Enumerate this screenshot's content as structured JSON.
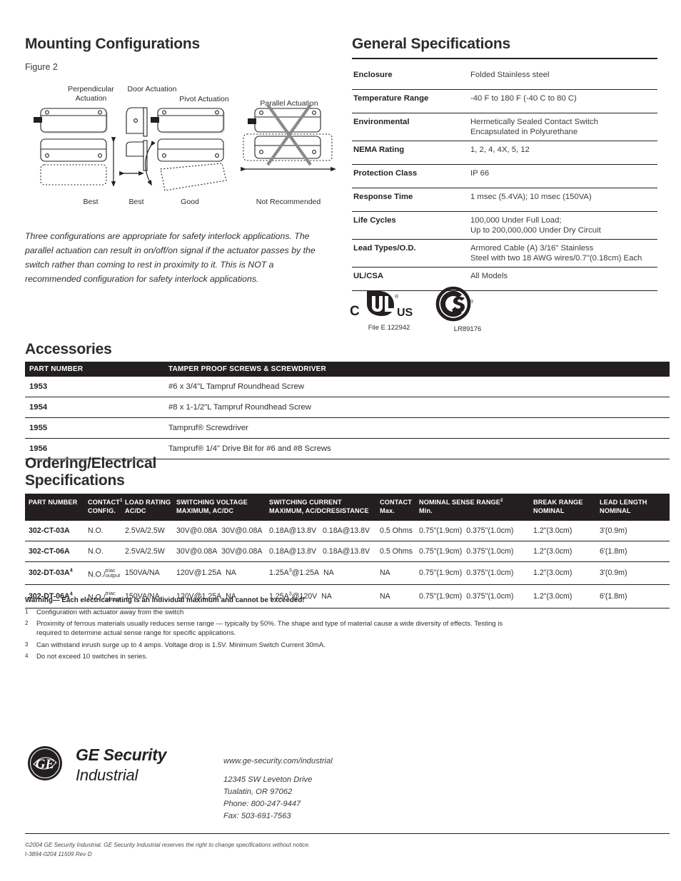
{
  "mounting": {
    "heading": "Mounting Configurations",
    "figure_label": "Figure 2",
    "captions_top": [
      "Perpendicular Actuation",
      "Door Actuation",
      "Pivot Actuation",
      "Parallel Actuation"
    ],
    "captions_bottom": [
      "Best",
      "Best",
      "Good",
      "Not Recommended"
    ],
    "note": "Three configurations are appropriate for safety interlock applications. The parallel actuation can result in on/off/on signal if the actuator passes by the switch rather than coming to rest in proximity to it. This is NOT a recommended configuration for safety interlock applications."
  },
  "general_specs": {
    "heading": "General Specifications",
    "rows": [
      {
        "key": "Enclosure",
        "values": [
          "Folded Stainless steel"
        ]
      },
      {
        "key": "Temperature Range",
        "values": [
          "-40  F to 180  F (-40  C to 80  C)"
        ]
      },
      {
        "key": "Environmental",
        "values": [
          "Hermetically Sealed Contact Switch",
          "Encapsulated in Polyurethane"
        ]
      },
      {
        "key": "NEMA Rating",
        "values": [
          "1, 2, 4, 4X, 5, 12"
        ]
      },
      {
        "key": "Protection Class",
        "values": [
          "IP 66"
        ]
      },
      {
        "key": "Response Time",
        "values": [
          "1 msec (5.4VA); 10 msec (150VA)"
        ]
      },
      {
        "key": "Life Cycles",
        "values": [
          "100,000 Under Full Load;",
          "Up to 200,000,000 Under Dry Circuit"
        ]
      },
      {
        "key": "Lead Types/O.D.",
        "values": [
          "Armored Cable (A) 3/16\" Stainless",
          "Steel with two 18 AWG wires/0.7\"(0.18cm) Each"
        ]
      },
      {
        "key": "UL/CSA",
        "values": [
          "All Models"
        ]
      }
    ]
  },
  "certifications": {
    "ul_file": "File E 122942",
    "csa_file": "LR89176",
    "ul_mark_left": "C",
    "ul_mark_right": "US"
  },
  "accessories": {
    "heading": "Accessories",
    "columns": [
      "PART NUMBER",
      "TAMPER PROOF SCREWS & SCREWDRIVER"
    ],
    "rows": [
      {
        "part": "1953",
        "desc": "#6 x 3/4\"L Tampruf Roundhead Screw"
      },
      {
        "part": "1954",
        "desc": "#8 x 1-1/2\"L Tampruf Roundhead Screw"
      },
      {
        "part": "1955",
        "desc": "Tampruf® Screwdriver"
      },
      {
        "part": "1956",
        "desc": "Tampruf® 1/4\" Drive Bit for #6 and #8 Screws"
      }
    ]
  },
  "ordering": {
    "heading_line1": "Ordering/Electrical",
    "heading_line2": "Specifications",
    "columns": [
      {
        "l1": "PART NUMBER",
        "l2": ""
      },
      {
        "l1": "CONTACT",
        "l1_sup": "1",
        "l2": "CONFIG."
      },
      {
        "l1": "LOAD RATING",
        "l2": "AC/DC"
      },
      {
        "l1": "SWITCHING VOLTAGE",
        "l2": "MAXIMUM, AC/DC"
      },
      {
        "l1": "SWITCHING CURRENT",
        "l2": "MAXIMUM, AC/DCRESISTANCE"
      },
      {
        "l1": "CONTACT",
        "l2": "Max."
      },
      {
        "l1": "NOMINAL SENSE RANGE",
        "l1_sup": "2",
        "l2": "Min."
      },
      {
        "l1": "BREAK RANGE",
        "l2": "NOMINAL"
      },
      {
        "l1": "LEAD LENGTH",
        "l2": "NOMINAL"
      }
    ],
    "rows": [
      {
        "part": "302-CT-03A",
        "part_sup": "",
        "config": "N.O.",
        "config_triac": false,
        "load": "2.5VA/2.5W",
        "volt_a": "30V@0.08A",
        "volt_b": "30V@0.08A",
        "cur_a": "0.18A@13.8V",
        "cur_a_sup": "",
        "cur_b": "0.18A@13.8V",
        "contact": "0.5 Ohms",
        "sense_a": "0.75\"(1.9cm)",
        "sense_b": "0.375\"(1.0cm)",
        "break_range": "1.2\"(3.0cm)",
        "lead": "3'(0.9m)"
      },
      {
        "part": "302-CT-06A",
        "part_sup": "",
        "config": "N.O.",
        "config_triac": false,
        "load": "2.5VA/2.5W",
        "volt_a": "30V@0.08A",
        "volt_b": "30V@0.08A",
        "cur_a": "0.18A@13.8V",
        "cur_a_sup": "",
        "cur_b": "0.18A@13.8V",
        "contact": "0.5 Ohms",
        "sense_a": "0.75\"(1.9cm)",
        "sense_b": "0.375\"(1.0cm)",
        "break_range": "1.2\"(3.0cm)",
        "lead": "6'(1.8m)"
      },
      {
        "part": "302-DT-03A",
        "part_sup": "4",
        "config": "N.O./",
        "config_triac": true,
        "load": "150VA/NA",
        "volt_a": "120V@1.25A",
        "volt_b": "NA",
        "cur_a": "1.25A",
        "cur_a_sup": "3",
        "cur_a_tail": "@1.25A",
        "cur_b": "NA",
        "contact": "NA",
        "sense_a": "0.75\"(1.9cm)",
        "sense_b": "0.375\"(1.0cm)",
        "break_range": "1.2\"(3.0cm)",
        "lead": "3'(0.9m)"
      },
      {
        "part": "302-DT-06A",
        "part_sup": "4",
        "config": "N.O./",
        "config_triac": true,
        "load": "150VA/NA",
        "volt_a": "120V@1.25A",
        "volt_b": "NA",
        "cur_a": "1.25A",
        "cur_a_sup": "3",
        "cur_a_tail": "@120V",
        "cur_b": "NA",
        "contact": "NA",
        "sense_a": "0.75\"(1.9cm)",
        "sense_b": "0.375\"(1.0cm)",
        "break_range": "1.2\"(3.0cm)",
        "lead": "6'(1.8m)"
      }
    ],
    "triac_line1": "triac",
    "triac_line2": "output",
    "warning": "Warning— Each electrical rating is an individual maximum and cannot be exceeded!",
    "footnotes": [
      {
        "num": "1",
        "text": "Configuration with actuator away from the switch"
      },
      {
        "num": "2",
        "text": "Proximity of ferrous materials usually reduces sense range — typically by 50%. The shape and type of material cause a wide diversity of effects. Testing is required to determine actual sense range for specific applications."
      },
      {
        "num": "3",
        "text": "Can withstand inrush surge up to 4 amps. Voltage drop is 1.5V. Minimum Switch Current 30mA."
      },
      {
        "num": "4",
        "text": "Do not exceed 10 switches in series."
      }
    ]
  },
  "footer": {
    "brand_line1": "GE Security",
    "brand_line2": "Industrial",
    "logo_mark": "GE",
    "url": "www.ge-security.com/industrial",
    "address_line1": "12345 SW Leveton Drive",
    "address_line2": "Tualatin, OR 97062",
    "phone": "Phone: 800-247-9447",
    "fax": "Fax: 503-691-7563",
    "copyright_line1": "©2004 GE Security Industrial. GE Security Industrial reserves the right to change specifications without notice.",
    "copyright_line2": "I-3894-0204 11509 Rev  D"
  }
}
